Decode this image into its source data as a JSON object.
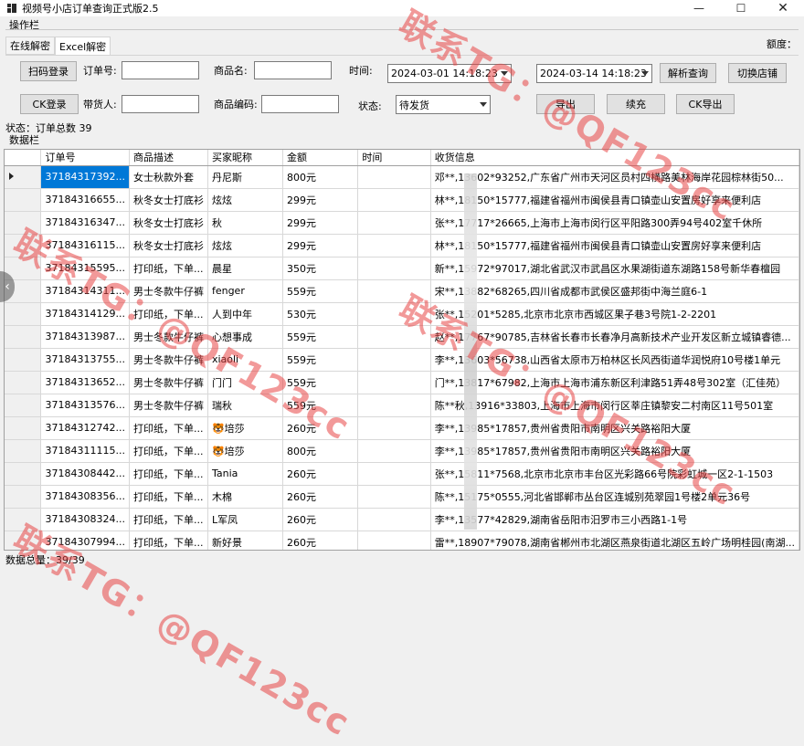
{
  "window": {
    "title": "视频号小店订单查询正式版2.5",
    "minimize": "—",
    "maximize": "☐",
    "close": "✕"
  },
  "ops": {
    "label": "操作栏",
    "tabs": [
      "在线解密",
      "Excel解密"
    ],
    "quota_label": "额度："
  },
  "form": {
    "scan_login": "扫码登录",
    "order_no_label": "订单号:",
    "product_name_label": "商品名:",
    "time_label": "时间:",
    "start_time": "2024-03-01 14:18:23",
    "end_time": "2024-03-14 14:18:23",
    "parse_query": "解析查询",
    "switch_shop": "切换店铺",
    "ck_login": "CK登录",
    "seller_label": "带货人:",
    "product_code_label": "商品编码:",
    "status_label": "状态:",
    "status_value": "待发货",
    "export": "导出",
    "continue": "续充",
    "ck_export": "CK导出"
  },
  "status_text": "状态：订单总数 39",
  "data_label": "数据栏",
  "table": {
    "columns": [
      "订单号",
      "商品描述",
      "买家昵称",
      "金额",
      "时间",
      "收货信息"
    ],
    "rows": [
      [
        "37184317392...",
        "女士秋款外套",
        "丹尼斯",
        "800元",
        "",
        "邓**,13602*93252,广东省广州市天河区员村四横路美林海岸花园棕林街50..."
      ],
      [
        "37184316655...",
        "秋冬女士打底衫",
        "炫炫",
        "299元",
        "",
        "林**,18150*15777,福建省福州市闽侯县青口镇壶山安置房好享来便利店"
      ],
      [
        "37184316347...",
        "秋冬女士打底衫",
        "秋",
        "299元",
        "",
        "张**,17717*26665,上海市上海市闵行区平阳路300弄94号402室千休所"
      ],
      [
        "37184316115...",
        "秋冬女士打底衫",
        "炫炫",
        "299元",
        "",
        "林**,18150*15777,福建省福州市闽侯县青口镇壶山安置房好享来便利店"
      ],
      [
        "37184315595...",
        "打印纸，下单...",
        "晨星",
        "350元",
        "",
        "新**,15972*97017,湖北省武汉市武昌区水果湖街道东湖路158号新华春檀园"
      ],
      [
        "37184314311...",
        "男士冬款牛仔裤",
        "fenger",
        "559元",
        "",
        "宋**,13882*68265,四川省成都市武侯区盛邦街中海兰庭6-1"
      ],
      [
        "37184314129...",
        "打印纸，下单...",
        "人到中年",
        "530元",
        "",
        "张**,15201*5285,北京市北京市西城区果子巷3号院1-2-2201"
      ],
      [
        "37184313987...",
        "男士冬款牛仔裤",
        "心想事成",
        "559元",
        "",
        "赵**,17767*90785,吉林省长春市长春净月高新技术产业开发区新立城镇睿德..."
      ],
      [
        "37184313755...",
        "男士冬款牛仔裤",
        "xiaoli",
        "559元",
        "",
        "李**,13603*56738,山西省太原市万柏林区长风西街道华润悦府10号楼1单元"
      ],
      [
        "37184313652...",
        "男士冬款牛仔裤",
        "门门",
        "559元",
        "",
        "门**,13817*67982,上海市上海市浦东新区利津路51弄48号302室（汇佳苑）"
      ],
      [
        "37184313576...",
        "男士冬款牛仔裤",
        "瑞秋",
        "559元",
        "",
        "陈**秋,13916*33803,上海市上海市闵行区莘庄镇黎安二村南区11号501室"
      ],
      [
        "37184312742...",
        "打印纸，下单...",
        "🐯培莎",
        "260元",
        "",
        "李**,13985*17857,贵州省贵阳市南明区兴关路裕阳大厦"
      ],
      [
        "37184311115...",
        "打印纸，下单...",
        "🐯培莎",
        "800元",
        "",
        "李**,13985*17857,贵州省贵阳市南明区兴关路裕阳大厦"
      ],
      [
        "37184308442...",
        "打印纸，下单...",
        "Tania",
        "260元",
        "",
        "张**,15811*7568,北京市北京市丰台区光彩路66号院彩虹城一区2-1-1503"
      ],
      [
        "37184308356...",
        "打印纸，下单...",
        "木棉",
        "260元",
        "",
        "陈**,15175*0555,河北省邯郸市丛台区连城别苑翠园1号楼2单元36号"
      ],
      [
        "37184308324...",
        "打印纸，下单...",
        "L军凤",
        "260元",
        "",
        "李**,13577*42829,湖南省岳阳市汨罗市三小西路1-1号"
      ],
      [
        "37184307994...",
        "打印纸，下单...",
        "新好景",
        "260元",
        "",
        "雷**,18907*79078,湖南省郴州市北湖区燕泉街道北湖区五岭广场明桂园(南湖..."
      ]
    ]
  },
  "count_text": "数据总量：39/39",
  "watermark": "联系TG：@QF123cc",
  "colors": {
    "selection": "#0078d7",
    "watermark": "#e84646"
  }
}
